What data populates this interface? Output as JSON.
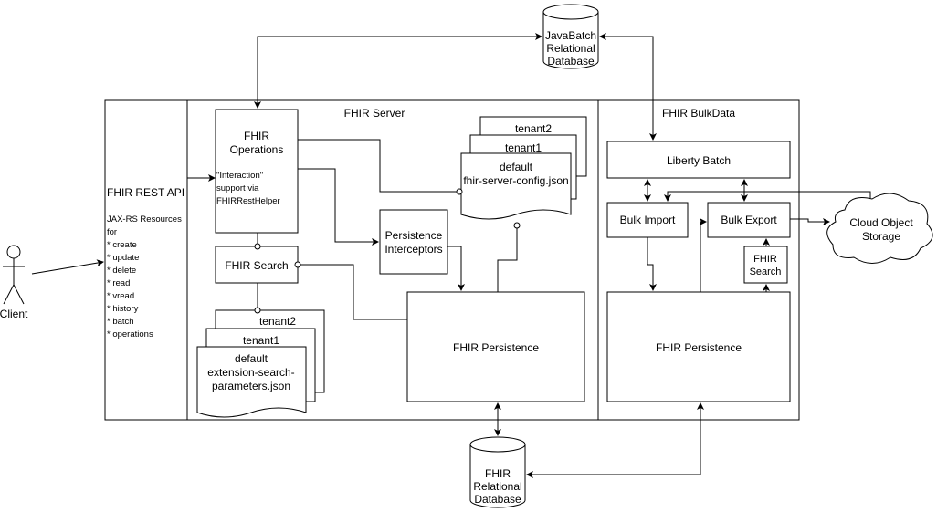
{
  "actors": {
    "client": "Client"
  },
  "databases": {
    "javabatch": [
      "JavaBatch",
      "Relational",
      "Database"
    ],
    "fhir": [
      "FHIR",
      "Relational",
      "Database"
    ]
  },
  "rest_api": {
    "title": "FHIR REST API",
    "lines": [
      "JAX-RS Resources",
      "for",
      "* create",
      "* update",
      "* delete",
      "* read",
      "* vread",
      "* history",
      "* batch",
      "* operations"
    ]
  },
  "fhir_server": {
    "title": "FHIR Server",
    "operations": {
      "title": [
        "FHIR",
        "Operations"
      ],
      "note": [
        "\"Interaction\"",
        "support via",
        "FHIRRestHelper"
      ]
    },
    "search": "FHIR Search",
    "interceptors": [
      "Persistence",
      "Interceptors"
    ],
    "persistence": "FHIR Persistence",
    "config_docs": {
      "tenant2": "tenant2",
      "tenant1": "tenant1",
      "default": [
        "default",
        "fhir-server-config.json"
      ]
    },
    "search_docs": {
      "tenant2": "tenant2",
      "tenant1": "tenant1",
      "default": [
        "default",
        "extension-search-",
        "parameters.json"
      ]
    }
  },
  "bulkdata": {
    "title": "FHIR BulkData",
    "liberty_batch": "Liberty Batch",
    "bulk_import": "Bulk Import",
    "bulk_export": "Bulk Export",
    "search": [
      "FHIR",
      "Search"
    ],
    "persistence": "FHIR Persistence"
  },
  "cloud": [
    "Cloud Object",
    "Storage"
  ]
}
